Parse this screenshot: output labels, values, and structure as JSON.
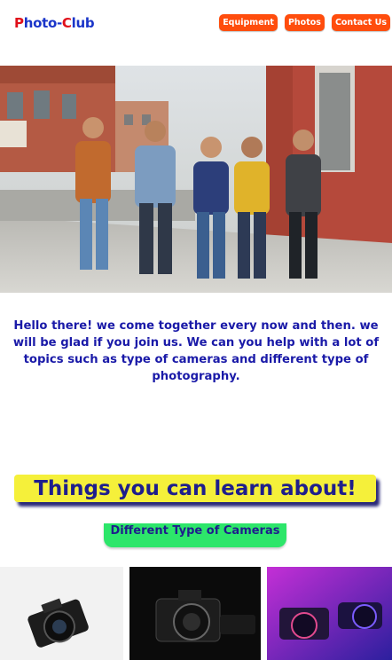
{
  "header": {
    "logo": {
      "p": "P",
      "hoto": "hoto-",
      "c": "C",
      "lub": "lub"
    },
    "nav": [
      "Equipment",
      "Photos",
      "Contact Us"
    ]
  },
  "hero": {
    "image": "group of friends walking on sidewalk photo"
  },
  "intro": {
    "text": "Hello there! we come together every now and then. we will be glad if you join us. We can you help with a lot of topics such as type of cameras and different type of photography."
  },
  "learn": {
    "heading": "Things you can learn about!",
    "subtitle": "Different Type of Cameras"
  },
  "gallery": [
    "camera-photo-1",
    "camera-photo-2",
    "camera-photo-3"
  ]
}
